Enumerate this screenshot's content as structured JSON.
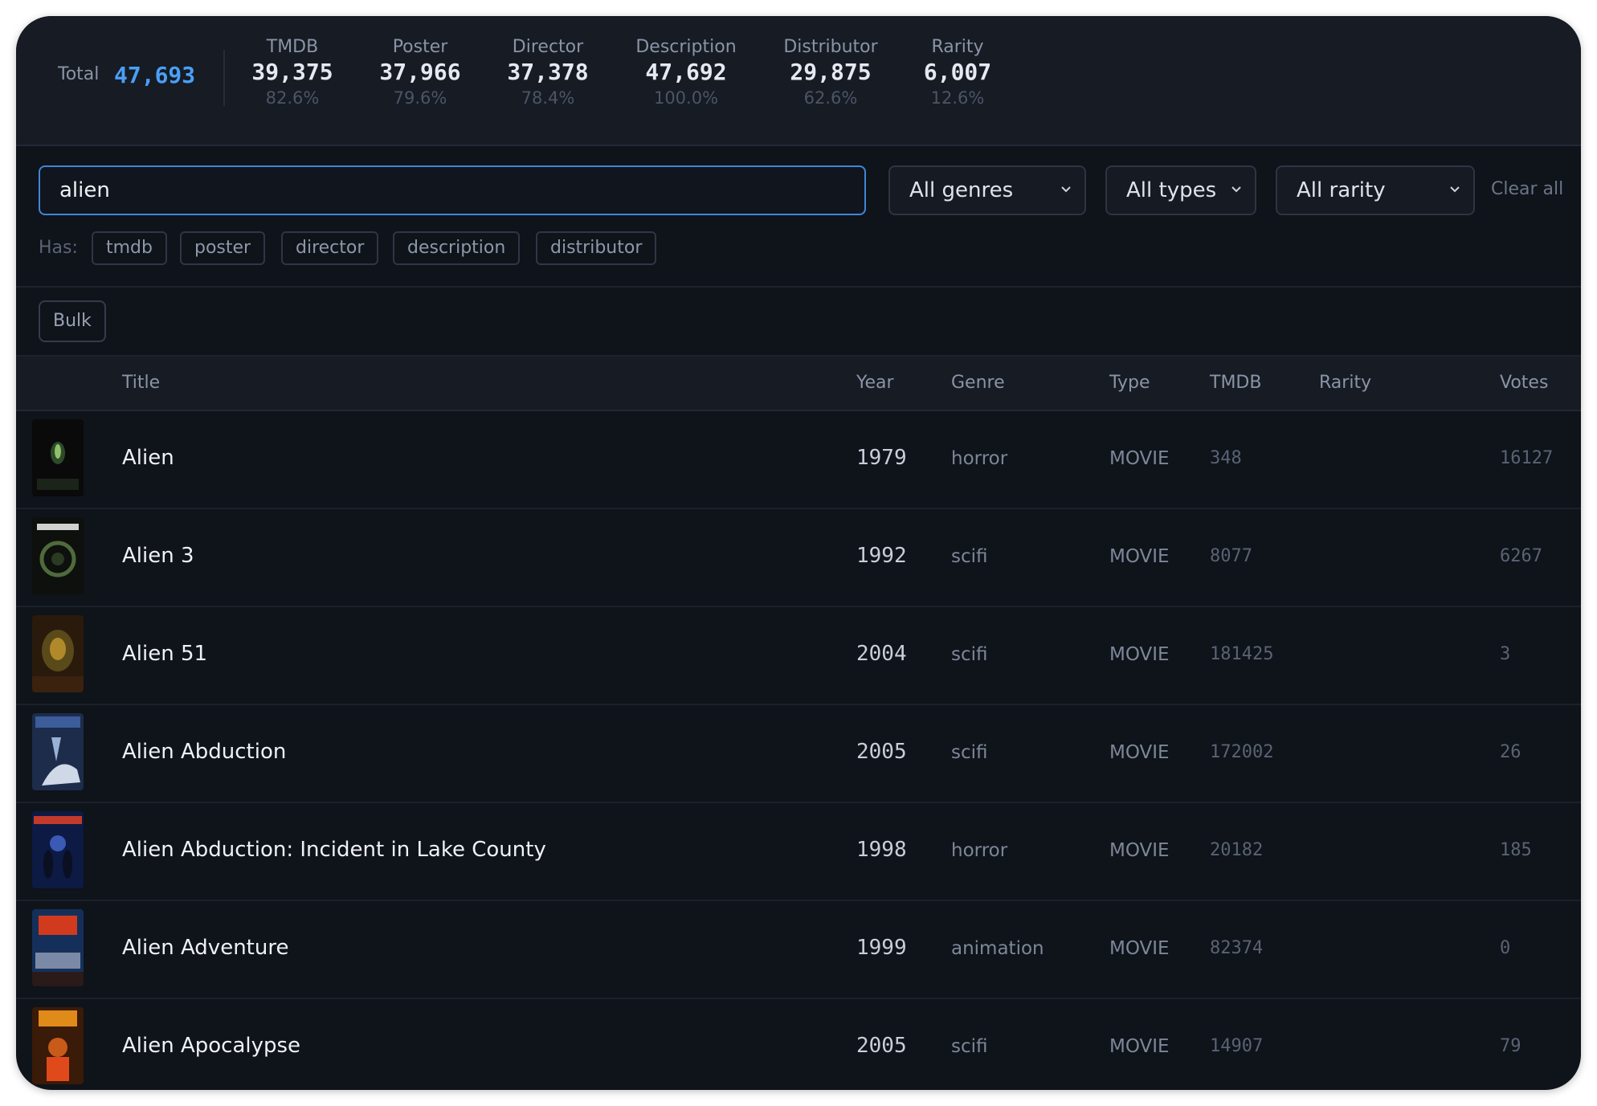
{
  "stats": {
    "total_label": "Total",
    "total_value": "47,693",
    "items": [
      {
        "label": "TMDB",
        "value": "39,375",
        "percent": "82.6%"
      },
      {
        "label": "Poster",
        "value": "37,966",
        "percent": "79.6%"
      },
      {
        "label": "Director",
        "value": "37,378",
        "percent": "78.4%"
      },
      {
        "label": "Description",
        "value": "47,692",
        "percent": "100.0%"
      },
      {
        "label": "Distributor",
        "value": "29,875",
        "percent": "62.6%"
      },
      {
        "label": "Rarity",
        "value": "6,007",
        "percent": "12.6%"
      }
    ]
  },
  "filters": {
    "search_value": "alien",
    "genre_select": "All genres",
    "type_select": "All types",
    "rarity_select": "All rarity",
    "clear_all": "Clear all",
    "has_label": "Has:",
    "has_chips": [
      "tmdb",
      "poster",
      "director",
      "description",
      "distributor"
    ]
  },
  "toolbar": {
    "bulk_label": "Bulk"
  },
  "table": {
    "columns": {
      "title": "Title",
      "year": "Year",
      "genre": "Genre",
      "type": "Type",
      "tmdb": "TMDB",
      "rarity": "Rarity",
      "votes": "Votes"
    },
    "rows": [
      {
        "title": "Alien",
        "year": "1979",
        "genre": "horror",
        "type": "MOVIE",
        "tmdb": "348",
        "rarity": "",
        "votes": "16127"
      },
      {
        "title": "Alien 3",
        "year": "1992",
        "genre": "scifi",
        "type": "MOVIE",
        "tmdb": "8077",
        "rarity": "",
        "votes": "6267"
      },
      {
        "title": "Alien 51",
        "year": "2004",
        "genre": "scifi",
        "type": "MOVIE",
        "tmdb": "181425",
        "rarity": "",
        "votes": "3"
      },
      {
        "title": "Alien Abduction",
        "year": "2005",
        "genre": "scifi",
        "type": "MOVIE",
        "tmdb": "172002",
        "rarity": "",
        "votes": "26"
      },
      {
        "title": "Alien Abduction: Incident in Lake County",
        "year": "1998",
        "genre": "horror",
        "type": "MOVIE",
        "tmdb": "20182",
        "rarity": "",
        "votes": "185"
      },
      {
        "title": "Alien Adventure",
        "year": "1999",
        "genre": "animation",
        "type": "MOVIE",
        "tmdb": "82374",
        "rarity": "",
        "votes": "0"
      },
      {
        "title": "Alien Apocalypse",
        "year": "2005",
        "genre": "scifi",
        "type": "MOVIE",
        "tmdb": "14907",
        "rarity": "",
        "votes": "79"
      }
    ]
  },
  "colors": {
    "accent": "#4a9ff5",
    "background": "#0f131a",
    "panel": "#161b24"
  }
}
